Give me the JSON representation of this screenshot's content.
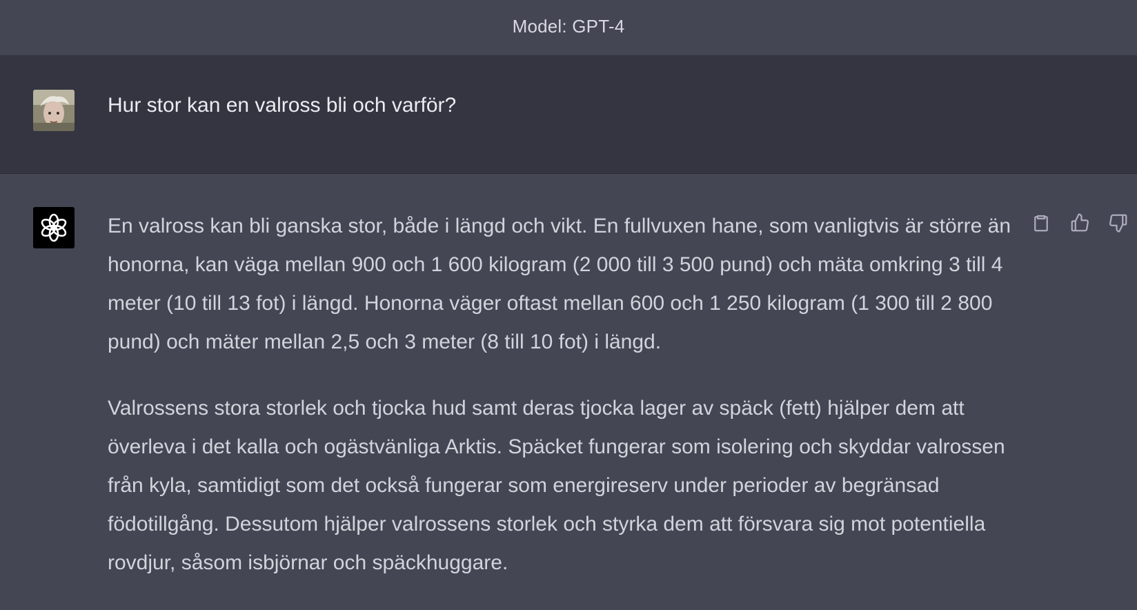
{
  "header": {
    "title": "Model: GPT-4"
  },
  "conversation": {
    "user_message": "Hur stor kan en valross bli och varför?",
    "assistant_paragraphs": [
      "En valross kan bli ganska stor, både i längd och vikt. En fullvuxen hane, som vanligtvis är större än honorna, kan väga mellan 900 och 1 600 kilogram (2 000 till 3 500 pund) och mäta omkring 3 till 4 meter (10 till 13 fot) i längd. Honorna väger oftast mellan 600 och 1 250 kilogram (1 300 till 2 800 pund) och mäter mellan 2,5 och 3 meter (8 till 10 fot) i längd.",
      "Valrossens stora storlek och tjocka hud samt deras tjocka lager av späck (fett) hjälper dem att överleva i det kalla och ogästvänliga Arktis. Späcket fungerar som isolering och skyddar valrossen från kyla, samtidigt som det också fungerar som energireserv under perioder av begränsad födotillgång. Dessutom hjälper valrossens storlek och styrka dem att försvara sig mot potentiella rovdjur, såsom isbjörnar och späckhuggare."
    ]
  },
  "actions": {
    "copy_icon": "clipboard-icon",
    "like_icon": "thumbs-up-icon",
    "dislike_icon": "thumbs-down-icon"
  },
  "colors": {
    "assistant_bg": "#444654",
    "user_bg": "#343541",
    "text": "#d1d5db"
  }
}
